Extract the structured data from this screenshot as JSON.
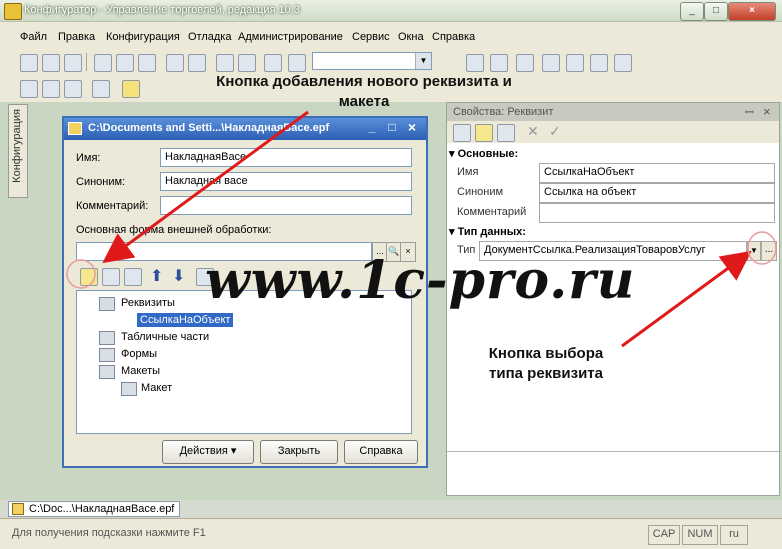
{
  "window": {
    "title": "Конфигуратор - Управление торговлей, редакция 10.3",
    "btn_min": "_",
    "btn_max": "□",
    "btn_close": "×"
  },
  "menu": {
    "items": [
      "Файл",
      "Правка",
      "Конфигурация",
      "Отладка",
      "Администрирование",
      "Сервис",
      "Окна",
      "Справка"
    ]
  },
  "side_panel": {
    "label": "Конфигурация"
  },
  "processing_window": {
    "title": "C:\\Documents and Setti...\\НакладнаяВасе.epf",
    "btn_min": "_",
    "btn_max": "□",
    "btn_close": "×",
    "labels": {
      "name": "Имя:",
      "synonym": "Синоним:",
      "comment": "Комментарий:",
      "main_form": "Основная форма внешней обработки:"
    },
    "values": {
      "name": "НакладнаяВасе",
      "synonym": "Накладная васе",
      "comment": "",
      "main_form": ""
    },
    "form_buttons": {
      "select": "...",
      "search": "🔍",
      "clear": "×"
    },
    "tree": {
      "requisites": "Реквизиты",
      "requisite_item": "СсылкаНаОбъект",
      "tabular": "Табличные части",
      "forms": "Формы",
      "templates": "Макеты",
      "template_item": "Макет"
    },
    "buttons": {
      "actions": "Действия",
      "close": "Закрыть",
      "help": "Справка"
    }
  },
  "properties": {
    "title": "Свойства: Реквизит",
    "pin": "ꟷ",
    "close": "×",
    "section_main": "Основные:",
    "section_type": "Тип данных:",
    "rows": [
      {
        "name": "Имя",
        "value": "СсылкаНаОбъект"
      },
      {
        "name": "Синоним",
        "value": "Ссылка на объект"
      },
      {
        "name": "Комментарий",
        "value": ""
      }
    ],
    "type_label": "Тип",
    "type_value": "ДокументСсылка.РеализацияТоваровУслуг",
    "type_btn": "..."
  },
  "window_tab": {
    "label": "C:\\Doc...\\НакладнаяВасе.epf"
  },
  "statusbar": {
    "hint": "Для получения подсказки нажмите F1",
    "cap": "CAP",
    "num": "NUM",
    "lang": "ru"
  },
  "annotations": {
    "add_button": "Кнопка добавления нового реквизита и макета",
    "type_button": "Кнопка выбора типа реквизита",
    "watermark": "www.1c-pro.ru"
  },
  "colors": {
    "arrow": "#e0191b",
    "title_blue": "#2c5fb5"
  }
}
